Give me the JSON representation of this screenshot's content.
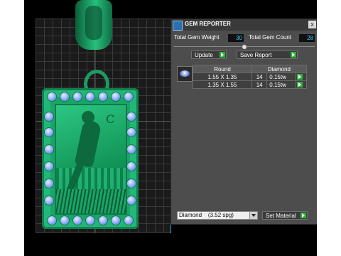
{
  "panel": {
    "title": "GEM REPORTER",
    "close_glyph": "x",
    "total_gem_weight_label": "Total Gem Weight",
    "total_gem_weight_value": "30",
    "total_gem_count_label": "Total Gem Count",
    "total_gem_count_value": "28",
    "slider_value": 0.5,
    "update_label": "Update",
    "save_report_label": "Save Report",
    "table": {
      "headers": [
        "Round",
        "Diamond"
      ],
      "rows": [
        {
          "size": "1.55 X 1.35",
          "count": "14",
          "weight": "0.15tw"
        },
        {
          "size": "1.35 X 1.55",
          "count": "14",
          "weight": "0.15tw"
        }
      ]
    },
    "material_select_value": "Diamond    (3.52 spg)",
    "set_material_label": "Set Material"
  },
  "viewport": {
    "moon_glyph": "C"
  },
  "colors": {
    "panel_bg": "#4d4d4d",
    "value_text": "#3cc8ff",
    "play_green": "#2bb33a",
    "model_green": "#1aa568"
  },
  "icons": [
    "gem-reporter-icon",
    "close-icon",
    "play-icon",
    "dropdown-arrow-icon",
    "round-gem-icon"
  ]
}
